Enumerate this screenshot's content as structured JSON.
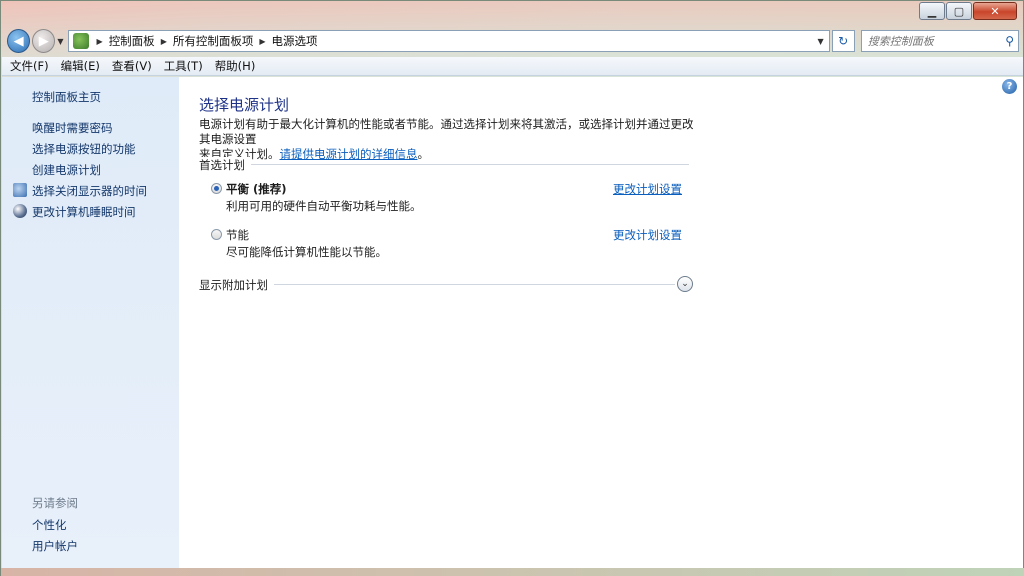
{
  "window": {
    "caption_buttons": {
      "minimize": "▁",
      "maximize": "▢",
      "close": "✕"
    }
  },
  "nav": {
    "back_glyph": "◀",
    "forward_glyph": "▶",
    "breadcrumbs": [
      "控制面板",
      "所有控制面板项",
      "电源选项"
    ],
    "refresh_glyph": "↻",
    "search_placeholder": "搜索控制面板",
    "icons": {
      "back": "back-arrow-icon",
      "forward": "forward-arrow-icon",
      "location": "control-panel-icon",
      "search": "magnifier-icon"
    }
  },
  "menu": {
    "items": [
      "文件(F)",
      "编辑(E)",
      "查看(V)",
      "工具(T)",
      "帮助(H)"
    ]
  },
  "sidebar": {
    "home": "控制面板主页",
    "links": [
      {
        "label": "唤醒时需要密码",
        "icon": ""
      },
      {
        "label": "选择电源按钮的功能",
        "icon": ""
      },
      {
        "label": "创建电源计划",
        "icon": ""
      },
      {
        "label": "选择关闭显示器的时间",
        "icon": "display-icon"
      },
      {
        "label": "更改计算机睡眠时间",
        "icon": "moon-icon"
      }
    ],
    "see_also_title": "另请参阅",
    "see_also": [
      "个性化",
      "用户帐户"
    ]
  },
  "main": {
    "title": "选择电源计划",
    "description_line1": "电源计划有助于最大化计算机的性能或者节能。通过选择计划来将其激活，或选择计划并通过更改其电源设置",
    "description_line2_prefix": "来自定义计划。",
    "description_link": "请提供电源计划的详细信息",
    "description_suffix": "。",
    "preferred_group": "首选计划",
    "plans": [
      {
        "name": "平衡 (推荐)",
        "description": "利用可用的硬件自动平衡功耗与性能。",
        "link": "更改计划设置",
        "selected": true
      },
      {
        "name": "节能",
        "description": "尽可能降低计算机性能以节能。",
        "link": "更改计划设置",
        "selected": false
      }
    ],
    "show_more": "显示附加计划",
    "expand_glyph": "⌄",
    "help_glyph": "?"
  }
}
